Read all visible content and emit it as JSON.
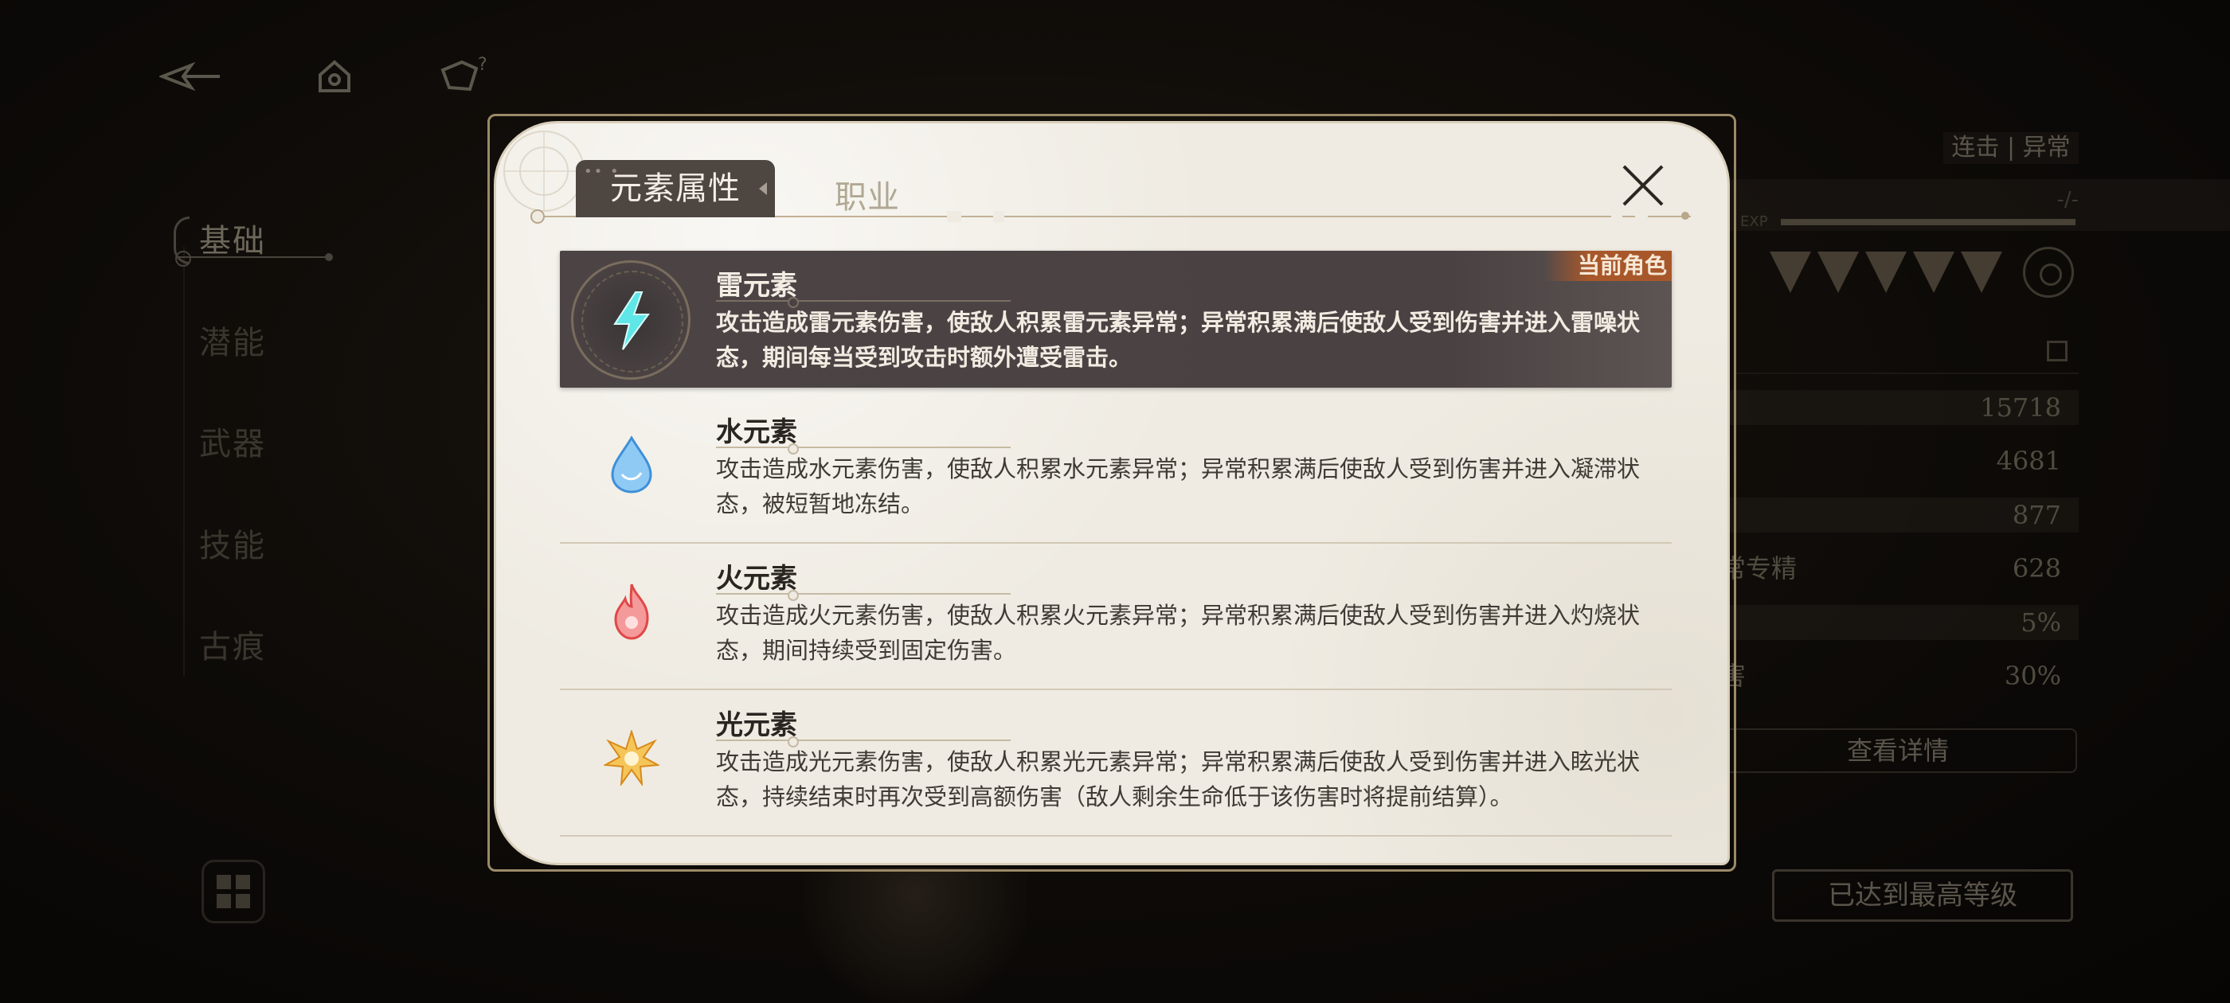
{
  "top_nav": {
    "back_icon": "back-arrow-icon",
    "home_icon": "home-icon",
    "help_icon": "help-icon"
  },
  "side_nav": {
    "items": [
      {
        "label": "基础",
        "active": true
      },
      {
        "label": "潜能",
        "active": false
      },
      {
        "label": "武器",
        "active": false
      },
      {
        "label": "技能",
        "active": false
      },
      {
        "label": "古痕",
        "active": false
      }
    ]
  },
  "right_panel": {
    "tag": "连击 | 异常",
    "exp_label": "EXP",
    "exp_value": "-/-",
    "star_count": 5,
    "stats": [
      {
        "label": "",
        "value": "15718"
      },
      {
        "label": "",
        "value": "4681"
      },
      {
        "label": "",
        "value": "877"
      },
      {
        "label": "常专精",
        "value": "628"
      },
      {
        "label": "",
        "value": "5%"
      },
      {
        "label": "害",
        "value": "30%"
      }
    ],
    "detail_button": "查看详情",
    "max_level_button": "已达到最高等级"
  },
  "modal": {
    "tabs": [
      {
        "label": "元素属性",
        "active": true
      },
      {
        "label": "职业",
        "active": false
      }
    ],
    "elements": [
      {
        "name": "雷元素",
        "icon": "lightning-element-icon",
        "color": "#5fe6e6",
        "current": true,
        "badge": "当前角色",
        "description": "攻击造成雷元素伤害，使敌人积累雷元素异常；异常积累满后使敌人受到伤害并进入雷噪状态，期间每当受到攻击时额外遭受雷击。"
      },
      {
        "name": "水元素",
        "icon": "water-element-icon",
        "color": "#6fb9f0",
        "current": false,
        "description": "攻击造成水元素伤害，使敌人积累水元素异常；异常积累满后使敌人受到伤害并进入凝滞状态，被短暂地冻结。"
      },
      {
        "name": "火元素",
        "icon": "fire-element-icon",
        "color": "#f07a7a",
        "current": false,
        "description": "攻击造成火元素伤害，使敌人积累火元素异常；异常积累满后使敌人受到伤害并进入灼烧状态，期间持续受到固定伤害。"
      },
      {
        "name": "光元素",
        "icon": "light-element-icon",
        "color": "#f2b544",
        "current": false,
        "description": "攻击造成光元素伤害，使敌人积累光元素异常；异常积累满后使敌人受到伤害并进入眩光状态，持续结束时再次受到高额伤害（敌人剩余生命低于该伤害时将提前结算）。"
      }
    ]
  }
}
